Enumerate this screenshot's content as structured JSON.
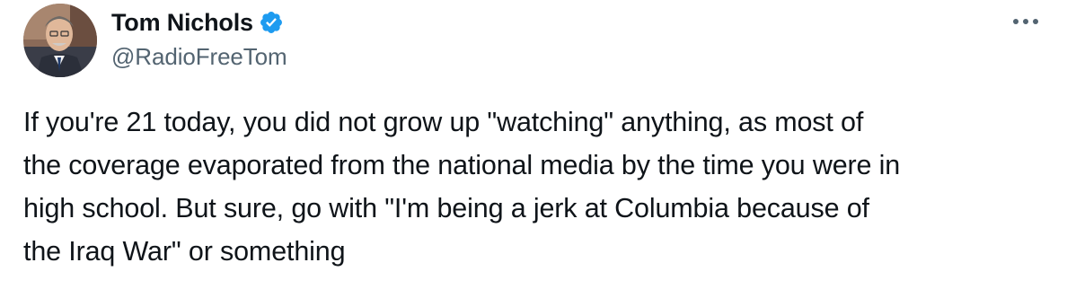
{
  "author": {
    "display_name": "Tom Nichols",
    "handle": "@RadioFreeTom",
    "verified": true,
    "avatar_icon": "profile-photo"
  },
  "menu": {
    "icon": "more-options-icon"
  },
  "tweet": {
    "lines": [
      "If you're 21 today, you did not grow up \"watching\" anything, as most of",
      "the coverage evaporated from the national media by the time you were in",
      "high school. But sure, go with \"I'm being a jerk at Columbia because of",
      "the Iraq War\" or something"
    ]
  },
  "colors": {
    "text_primary": "#0f1419",
    "text_secondary": "#536471",
    "verified_blue": "#1d9bf0"
  }
}
